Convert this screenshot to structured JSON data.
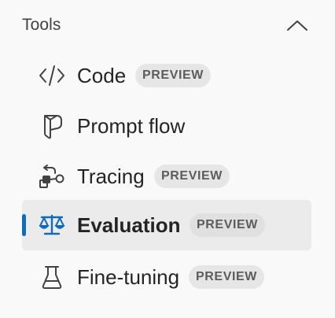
{
  "section": {
    "title": "Tools",
    "collapse_icon": "chevron-up-icon"
  },
  "nav": {
    "items": [
      {
        "label": "Code",
        "icon": "code-icon",
        "badge": "PREVIEW",
        "active": false
      },
      {
        "label": "Prompt flow",
        "icon": "prompt-flow-icon",
        "badge": "",
        "active": false
      },
      {
        "label": "Tracing",
        "icon": "tracing-icon",
        "badge": "PREVIEW",
        "active": false
      },
      {
        "label": "Evaluation",
        "icon": "scales-icon",
        "badge": "PREVIEW",
        "active": true
      },
      {
        "label": "Fine-tuning",
        "icon": "beaker-icon",
        "badge": "PREVIEW",
        "active": false
      }
    ]
  },
  "colors": {
    "accent": "#0f6cbd",
    "active_background": "#ebebeb",
    "badge_background": "#e6e6e6",
    "badge_text": "#5c5c5c"
  }
}
